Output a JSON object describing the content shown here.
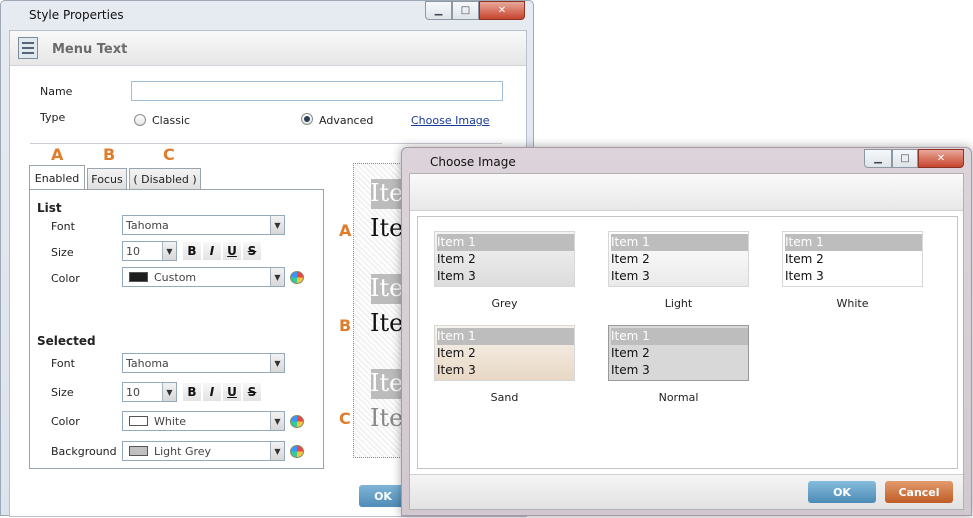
{
  "style_window": {
    "title": "Style Properties",
    "header_title": "Menu Text",
    "name_label": "Name",
    "name_value": "",
    "type_label": "Type",
    "type_classic": "Classic",
    "type_advanced": "Advanced",
    "type_selected": "Advanced",
    "choose_image_link": "Choose Image",
    "state_letters": [
      "A",
      "B",
      "C"
    ],
    "tabs": [
      "Enabled",
      "Focus",
      "( Disabled )"
    ],
    "active_tab": "Enabled",
    "list_section": {
      "title": "List",
      "font_label": "Font",
      "font_value": "Tahoma",
      "size_label": "Size",
      "size_value": "10",
      "color_label": "Color",
      "color_value": "Custom",
      "color_swatch": "#1e1e1e"
    },
    "selected_section": {
      "title": "Selected",
      "font_label": "Font",
      "font_value": "Tahoma",
      "size_label": "Size",
      "size_value": "10",
      "color_label": "Color",
      "color_value": "White",
      "color_swatch": "#ffffff",
      "background_label": "Background",
      "background_value": "Light Grey",
      "background_swatch": "#c0c0c0"
    },
    "format_buttons": [
      "B",
      "I",
      "U",
      "S"
    ],
    "preview_labels": [
      "A",
      "B",
      "C"
    ],
    "preview_text": "Ite",
    "ok_label": "OK"
  },
  "choose_image_dialog": {
    "title": "Choose Image",
    "themes": [
      {
        "name": "Grey",
        "items": [
          "Item 1",
          "Item 2",
          "Item 3"
        ]
      },
      {
        "name": "Light",
        "items": [
          "Item 1",
          "Item 2",
          "Item 3"
        ]
      },
      {
        "name": "White",
        "items": [
          "Item 1",
          "Item 2",
          "Item 3"
        ]
      },
      {
        "name": "Sand",
        "items": [
          "Item 1",
          "Item 2",
          "Item 3"
        ]
      },
      {
        "name": "Normal",
        "items": [
          "Item 1",
          "Item 2",
          "Item 3"
        ]
      }
    ],
    "ok_label": "OK",
    "cancel_label": "Cancel"
  },
  "colors": {
    "accent_orange": "#e07d2c",
    "ok_blue": "#4f8db8",
    "cancel_orange": "#bf5c26"
  }
}
